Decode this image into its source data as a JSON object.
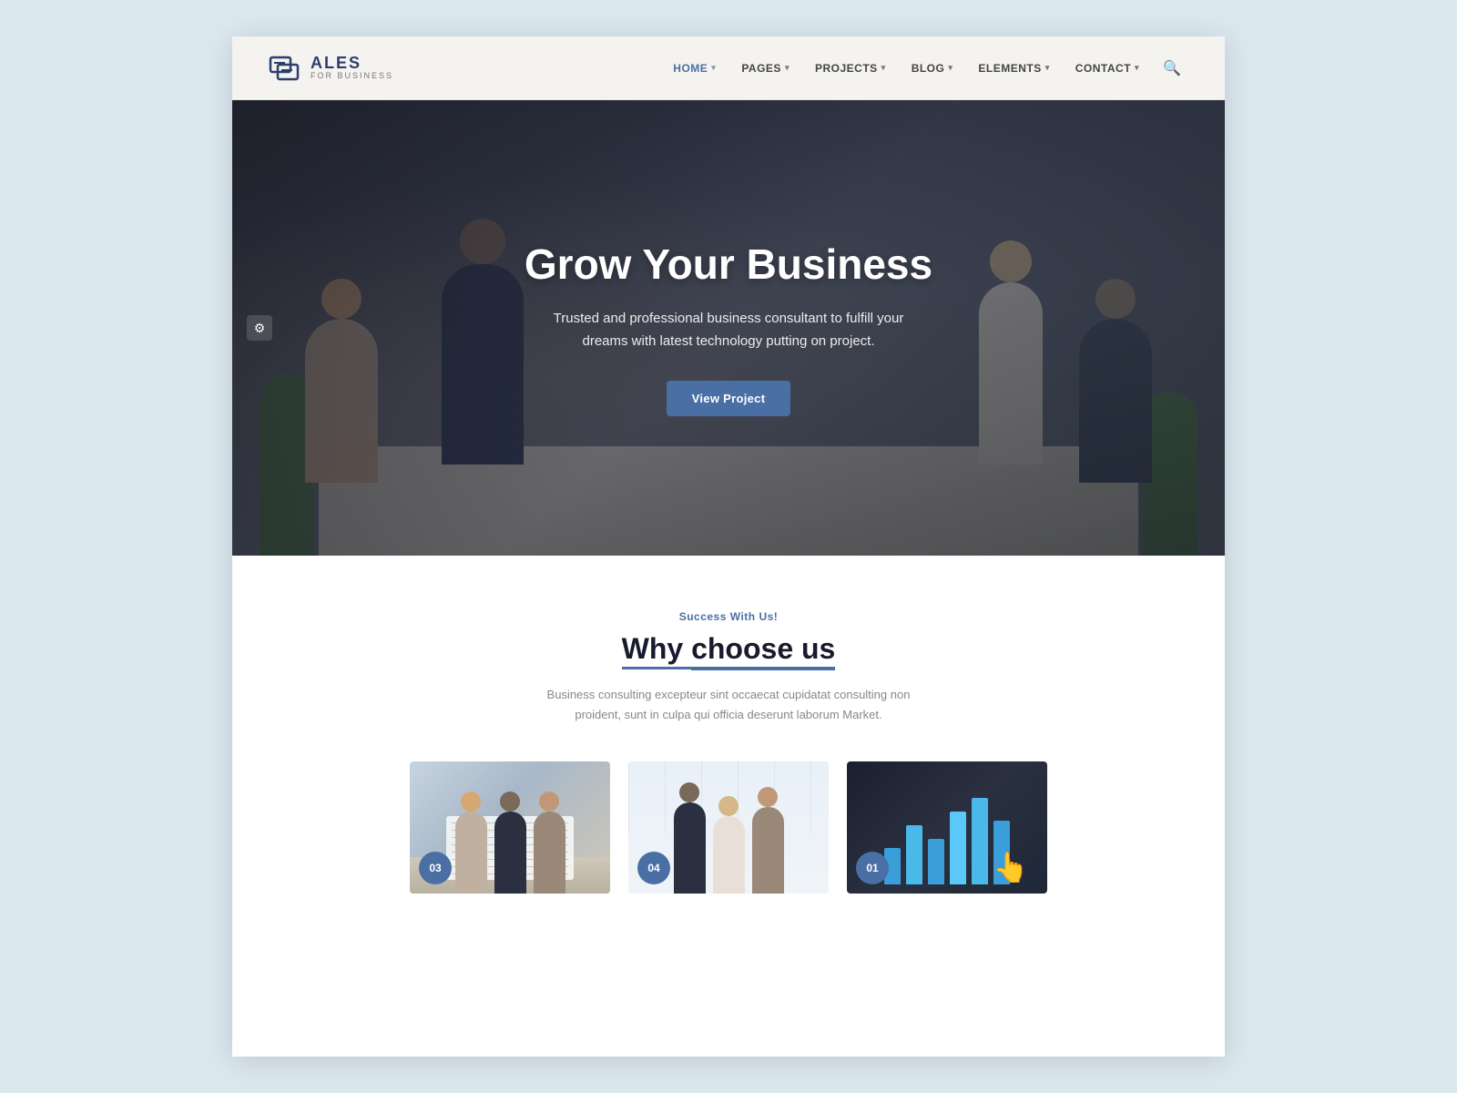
{
  "brand": {
    "name": "ALES",
    "tagline": "FOR BUSINESS"
  },
  "navbar": {
    "links": [
      {
        "label": "HOME",
        "active": true,
        "hasDropdown": true
      },
      {
        "label": "PAGES",
        "active": false,
        "hasDropdown": true
      },
      {
        "label": "PROJECTS",
        "active": false,
        "hasDropdown": true
      },
      {
        "label": "BLOG",
        "active": false,
        "hasDropdown": true
      },
      {
        "label": "ELEMENTS",
        "active": false,
        "hasDropdown": true
      },
      {
        "label": "CONTACT",
        "active": false,
        "hasDropdown": true
      }
    ]
  },
  "hero": {
    "title": "Grow Your Business",
    "subtitle": "Trusted and professional business consultant to fulfill your dreams with latest technology putting on project.",
    "button_label": "View Project"
  },
  "why_section": {
    "tagline": "Success With Us!",
    "title_prefix": "Why ",
    "title_highlight": "choose us",
    "description": "Business consulting excepteur sint occaecat cupidatat consulting non proident, sunt in culpa qui officia deserunt laborum Market.",
    "cards": [
      {
        "badge": "03",
        "alt": "Team meeting around table"
      },
      {
        "badge": "04",
        "alt": "Business professionals discussing"
      },
      {
        "badge": "01",
        "alt": "Financial growth chart"
      }
    ]
  },
  "colors": {
    "accent": "#4a6fa5",
    "dark": "#1a1a2e",
    "light_bg": "#f5f3f0",
    "page_bg": "#dce8f0"
  }
}
